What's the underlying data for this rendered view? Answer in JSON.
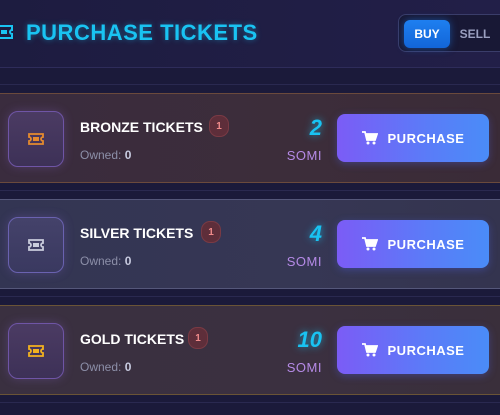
{
  "header": {
    "title": "PURCHASE TICKETS",
    "icon": "ticket-icon",
    "accent_color": "#19c3f2"
  },
  "toggle": {
    "buy_label": "BUY",
    "sell_label": "SELL",
    "selected": "BUY"
  },
  "tickets": [
    {
      "name": "BRONZE TICKETS",
      "badge": "1",
      "owned_label": "Owned:",
      "owned_value": "0",
      "price": "2",
      "currency": "SOMI",
      "button_label": "PURCHASE",
      "icon": "ticket-icon",
      "icon_color": "#e58a2e"
    },
    {
      "name": "SILVER TICKETS",
      "badge": "1",
      "owned_label": "Owned:",
      "owned_value": "0",
      "price": "4",
      "currency": "SOMI",
      "button_label": "PURCHASE",
      "icon": "ticket-icon",
      "icon_color": "#c9ccdc"
    },
    {
      "name": "GOLD TICKETS",
      "badge": "1",
      "owned_label": "Owned:",
      "owned_value": "0",
      "price": "10",
      "currency": "SOMI",
      "button_label": "PURCHASE",
      "icon": "ticket-icon",
      "icon_color": "#f3b21f"
    }
  ]
}
